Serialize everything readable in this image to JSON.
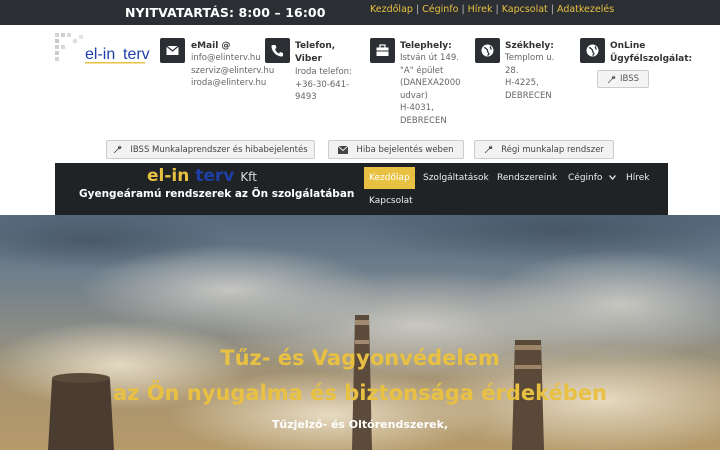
{
  "topbar": {
    "hours": "NYITVATARTÁS: 8:00 – 16:00",
    "links": [
      "Kezdőlap",
      "Céginfo",
      "Hírek",
      "Kapcsolat",
      "Adatkezelés"
    ],
    "separator": "|"
  },
  "logo": {
    "text_a": "el-in",
    "text_b": "terv"
  },
  "info": {
    "email": {
      "title": "eMail @",
      "lines": [
        "info@elinterv.hu",
        "szerviz@elinterv.hu",
        "iroda@elinterv.hu"
      ]
    },
    "phone": {
      "title": [
        "Telefon,",
        "Viber"
      ],
      "lines": [
        "Iroda telefon:",
        "+36-30-641-",
        "9493"
      ]
    },
    "site": {
      "title": "Telephely:",
      "lines": [
        "István út 149.",
        "\"A\" épület",
        "(DANEXA2000",
        "udvar)",
        "H-4031,",
        "DEBRECEN"
      ]
    },
    "hq": {
      "title": "Székhely:",
      "lines": [
        "Templom u.",
        "28.",
        "H-4225,",
        "DEBRECEN"
      ]
    },
    "online": {
      "title": [
        "OnLine",
        "Ügyfélszolgálat:"
      ],
      "button": "IBSS"
    }
  },
  "actions": {
    "ibss": "IBSS Munkalaprendszer és hibabejelentés",
    "report": "Hiba bejelentés weben",
    "old": "Régi munkalap rendszer"
  },
  "nav": {
    "brand_a": "el-in",
    "brand_b": "terv",
    "brand_c": "Kft",
    "tagline": "Gyengeáramú rendszerek az Ön szolgálatában",
    "items": [
      "Kezdőlap",
      "Szolgáltatások",
      "Rendszereink",
      "Céginfo",
      "Hírek",
      "Kapcsolat"
    ]
  },
  "hero": {
    "line1": "Tűz- és Vagyonvédelem",
    "line2": "az Ön nyugalma és biztonsága érdekében",
    "sub": "Tűzjelző- és Oltórendszerek,"
  },
  "colors": {
    "accent": "#e9c142",
    "dark": "#2b2f33",
    "brand_blue": "#1f3fa8"
  },
  "icons": [
    "envelope-icon",
    "phone-icon",
    "briefcase-icon",
    "globe-icon",
    "wrench-icon",
    "chevron-down-icon"
  ]
}
